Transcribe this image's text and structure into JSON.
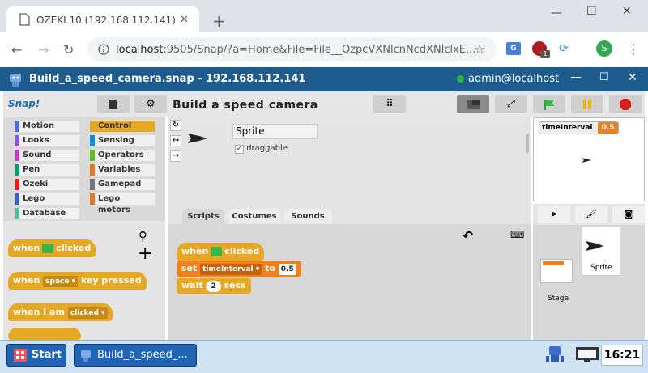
{
  "browser": {
    "tab_title": "OZEKI 10 (192.168.112.141)",
    "url_host": "localhost",
    "url_rest": ":9505/Snap/?a=Home&File=File__QzpcVXNlcnNcdXNlclxE...",
    "avatar_letter": "S",
    "ext_badge": "1"
  },
  "app": {
    "title": "Build_a_speed_camera.snap - 192.168.112.141",
    "user": "admin@localhost"
  },
  "snap": {
    "logo": "Snap!",
    "project_name": "Build  a  speed  camera"
  },
  "categories": [
    {
      "label": "Motion",
      "color": "#4a6cd4"
    },
    {
      "label": "Control",
      "color": "#e6a822",
      "selected": true
    },
    {
      "label": "Looks",
      "color": "#8a55d7"
    },
    {
      "label": "Sensing",
      "color": "#0494dc"
    },
    {
      "label": "Sound",
      "color": "#bb42c3"
    },
    {
      "label": "Operators",
      "color": "#62c213"
    },
    {
      "label": "Pen",
      "color": "#0e9a6c"
    },
    {
      "label": "Variables",
      "color": "#f3761d"
    },
    {
      "label": "Ozeki",
      "color": "#e0201f"
    },
    {
      "label": "Gamepad",
      "color": "#777777"
    },
    {
      "label": "Lego",
      "color": "#3b62b8"
    },
    {
      "label": "Lego motors",
      "color": "#f3761d"
    },
    {
      "label": "Database",
      "color": "#4fbf9f"
    }
  ],
  "palette": {
    "when": "when",
    "clicked": "clicked",
    "key_key": "space",
    "key_pressed": "key pressed",
    "when_i_am": "when I am",
    "when_i_am_opt": "clicked"
  },
  "sprite": {
    "name": "Sprite",
    "draggable_label": "draggable",
    "draggable_check": "✓"
  },
  "tabs": {
    "scripts": "Scripts",
    "costumes": "Costumes",
    "sounds": "Sounds"
  },
  "script": {
    "when": "when",
    "clicked": "clicked",
    "set": "set",
    "var": "timeInterval",
    "to": "to",
    "val": "0.5",
    "wait": "wait",
    "secs_val": "2",
    "secs": "secs"
  },
  "stage": {
    "watcher_name": "timeInterval",
    "watcher_value": "0.5",
    "stage_label": "Stage",
    "sprite_label": "Sprite"
  },
  "taskbar": {
    "start": "Start",
    "task": "Build_a_speed_...",
    "clock": "16:21"
  }
}
